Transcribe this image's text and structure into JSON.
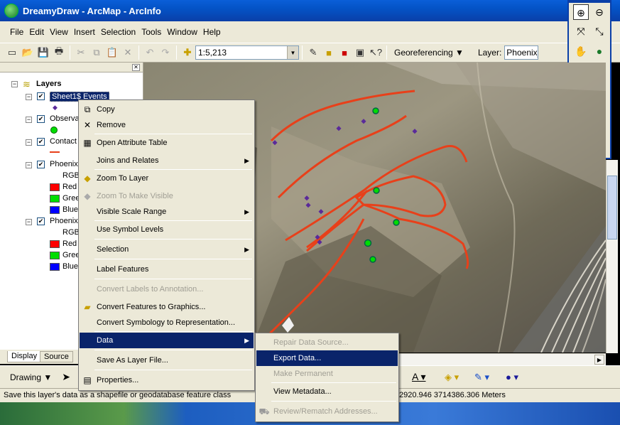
{
  "window": {
    "title": "DreamyDraw - ArcMap - ArcInfo"
  },
  "menu": [
    "File",
    "Edit",
    "View",
    "Insert",
    "Selection",
    "Tools",
    "Window",
    "Help"
  ],
  "toolbar": {
    "scale_value": "1:5,213",
    "georef_label": "Georeferencing",
    "layer_label": "Layer:",
    "layer_value": "Phoenix_"
  },
  "toc": {
    "root_label": "Layers",
    "layers": [
      {
        "name": "Sheet1$ Events"
      },
      {
        "name": "Observa"
      },
      {
        "name": "Contact"
      },
      {
        "name": "Phoenix",
        "rgb": "RGB",
        "bands": [
          "Red",
          "Gree",
          "Blue"
        ]
      },
      {
        "name": "Phoenix",
        "rgb": "RGB",
        "bands": [
          "Red",
          "Gree",
          "Blue"
        ]
      }
    ],
    "tabs": [
      "Display",
      "Source"
    ]
  },
  "context_menu": {
    "items": [
      "Copy",
      "Remove",
      "Open Attribute Table",
      "Joins and Relates",
      "Zoom To Layer",
      "Zoom To Make Visible",
      "Visible Scale Range",
      "Use Symbol Levels",
      "Selection",
      "Label Features",
      "Convert Labels to Annotation...",
      "Convert Features to Graphics...",
      "Convert Symbology to Representation...",
      "Data",
      "Save As Layer File...",
      "Properties..."
    ]
  },
  "data_submenu": {
    "items": [
      "Repair Data Source...",
      "Export Data...",
      "Make Permanent",
      "View Metadata...",
      "Review/Rematch Addresses..."
    ]
  },
  "drawbar": {
    "drawing_label": "Drawing"
  },
  "status": {
    "message": "Save this layer's data as a shapefile or geodatabase feature class",
    "coords": "2920.946  3714386.306 Meters"
  },
  "colors": {
    "red": "#ff0000",
    "green": "#00dd00",
    "blue": "#0000ff",
    "contact_line": "#e8401a",
    "highlight": "#0a246a"
  }
}
